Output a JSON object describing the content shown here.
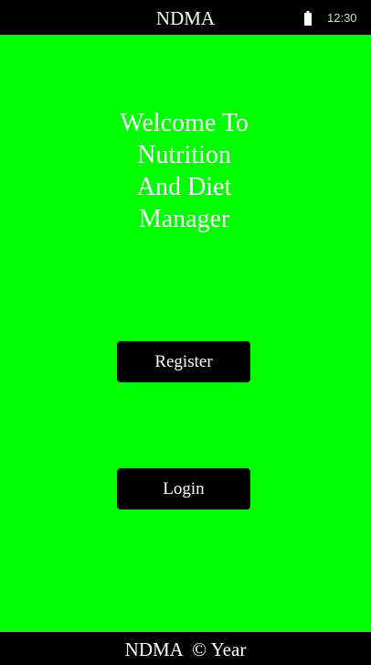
{
  "status_bar": {
    "title": "NDMA",
    "time": "12:30",
    "battery_icon": "battery-icon"
  },
  "main": {
    "welcome_lines": [
      "Welcome To",
      "Nutrition",
      "And Diet",
      "Manager"
    ],
    "register_label": "Register",
    "login_label": "Login"
  },
  "footer": {
    "text": "NDMA  © Year"
  },
  "colors": {
    "background": "#00ff00",
    "bars": "#000000",
    "text": "#ffffff",
    "button": "#000000"
  }
}
